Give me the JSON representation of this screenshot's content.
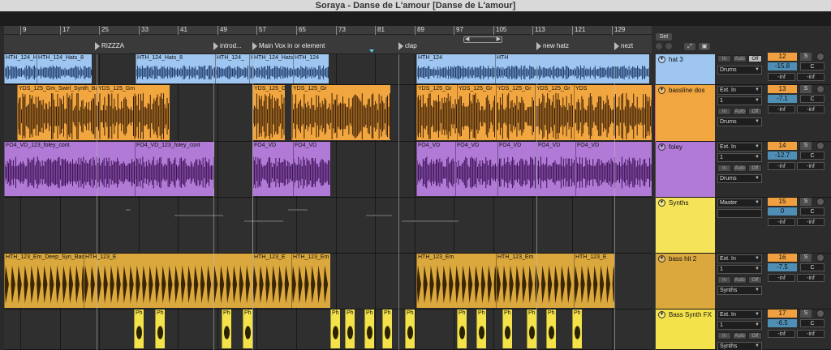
{
  "window": {
    "title": "Soraya - Danse de L'amour  [Danse de L'amour]"
  },
  "ruler": {
    "bars": [
      "9",
      "17",
      "25",
      "33",
      "41",
      "49",
      "57",
      "65",
      "73",
      "81",
      "89",
      "97",
      "105",
      "113",
      "121",
      "129"
    ]
  },
  "locators": [
    {
      "label": "RIZZZA"
    },
    {
      "label": "introd..."
    },
    {
      "label": "Main Vox in or element"
    },
    {
      "label": "clap"
    },
    {
      "label": "new hatz"
    },
    {
      "label": "nezt"
    }
  ],
  "header_controls": {
    "set_label": "Set"
  },
  "colors": {
    "blue": "#9ec6f0",
    "orange": "#f2a63f",
    "purple": "#b07ad6",
    "yellow": "#f5e35a",
    "gold": "#dba83e",
    "bright_yellow": "#f3e24a"
  },
  "tracks": [
    {
      "name": "hat 3",
      "color": "#9ec6f0",
      "input": "Drums",
      "monitor": [
        "In",
        "Auto",
        "Off"
      ],
      "number": "12",
      "solo": "S",
      "volume": "-15.8",
      "pan": "C",
      "meter": [
        "-inf",
        "-inf"
      ],
      "clips": [
        {
          "name": "HTH_124_Hat"
        },
        {
          "name": "HTH_124_Hats_8"
        },
        {
          "name": "HTH_124_Hats_8"
        },
        {
          "name": "HTH_124_"
        },
        {
          "name": "HTH_124_Hats"
        },
        {
          "name": "HTH_124_Hats_8"
        },
        {
          "name": "HTH_124"
        },
        {
          "name": "HTH_124"
        },
        {
          "name": "HTH"
        }
      ]
    },
    {
      "name": "bassline dos",
      "color": "#f2a63f",
      "input": "Ext. In",
      "input_channel": "1",
      "output": "Drums",
      "monitor": [
        "In",
        "Auto",
        "Off"
      ],
      "number": "13",
      "solo": "S",
      "volume": "-7.1",
      "pan": "C",
      "meter": [
        "-inf",
        "-inf"
      ],
      "clips": [
        {
          "name": "YDS_125_Gm_Swirl_Synth_Bass_1"
        },
        {
          "name": "YDS_125_Gm"
        },
        {
          "name": "YDS_125_Gm_Swirl_Synth_Bas"
        },
        {
          "name": "YDS_125_Gr"
        },
        {
          "name": "YDS_125_Gr"
        },
        {
          "name": "YDS_125_Gr"
        },
        {
          "name": "YDS_125_Gr"
        },
        {
          "name": "YDS_125_Gr"
        },
        {
          "name": "YDS"
        }
      ]
    },
    {
      "name": "foley",
      "color": "#b07ad6",
      "input": "Ext. In",
      "input_channel": "1",
      "output": "Drums",
      "monitor": [
        "In",
        "Auto",
        "Off"
      ],
      "number": "14",
      "solo": "S",
      "volume": "-12.7",
      "pan": "C",
      "meter": [
        "-inf",
        "-inf"
      ],
      "clips": [
        {
          "name": "FO4_VD_123_foley_cont"
        },
        {
          "name": "FO4_VD_123_foley_cont"
        },
        {
          "name": "FO4_VD"
        },
        {
          "name": "FO4_VD"
        },
        {
          "name": "FO4_VD"
        },
        {
          "name": "FO4_VD"
        },
        {
          "name": "FO4_VD"
        },
        {
          "name": "FO4_VD"
        },
        {
          "name": "FO4_VD"
        }
      ]
    },
    {
      "name": "Synths",
      "color": "#f5e35a",
      "input": "Master",
      "number": "15",
      "solo": "S",
      "volume": "0",
      "pan": "C",
      "meter": [
        "-inf",
        "-inf"
      ],
      "clips": []
    },
    {
      "name": "bass hit 2",
      "color": "#dba83e",
      "input": "Ext. In",
      "input_channel": "1",
      "output": "Synths",
      "monitor": [
        "In",
        "Auto",
        "Off"
      ],
      "number": "16",
      "solo": "S",
      "volume": "-7.5",
      "pan": "C",
      "meter": [
        "-inf",
        "-inf"
      ],
      "clips": [
        {
          "name": "HTH_123_Em_Deep_Syn_Bass"
        },
        {
          "name": "HTH_123_E"
        },
        {
          "name": "HTH_123_E"
        },
        {
          "name": "HTH_123_Em"
        },
        {
          "name": "HTH_123_Em"
        },
        {
          "name": "HTH_123_Em"
        },
        {
          "name": "HTH_123_E"
        }
      ]
    },
    {
      "name": "Bass Synth FX",
      "color": "#f3e24a",
      "input": "Ext. In",
      "input_channel": "1",
      "output": "Synths",
      "monitor": [
        "In",
        "Auto",
        "Off"
      ],
      "number": "17",
      "solo": "S",
      "volume": "-6.5",
      "pan": "C",
      "meter": [
        "-inf",
        "-inf"
      ],
      "clips": [
        {
          "name": "Ph"
        },
        {
          "name": "Ph"
        },
        {
          "name": "Ph"
        },
        {
          "name": "Ph"
        },
        {
          "name": "Ph"
        },
        {
          "name": "Ph"
        },
        {
          "name": "Ph"
        },
        {
          "name": "Ph"
        },
        {
          "name": "Ph"
        },
        {
          "name": "Ph"
        },
        {
          "name": "Ph"
        },
        {
          "name": "Ph"
        },
        {
          "name": "Ph"
        },
        {
          "name": "Ph"
        },
        {
          "name": "Ph"
        }
      ]
    }
  ]
}
